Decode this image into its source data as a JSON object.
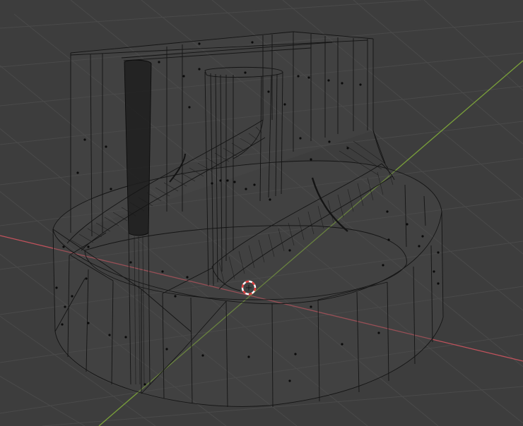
{
  "viewport": {
    "mode": "wireframe",
    "background_color": "#3d3d3d",
    "grid_color": "#4a4a4a",
    "x_axis_color": "#c1525c",
    "y_axis_color": "#7aa03a",
    "wire_color": "#141414",
    "surface_tint": "#4b4b4b",
    "cursor_colors": [
      "#e23b3b",
      "#ffffff"
    ],
    "icons": [
      "3d-cursor-icon"
    ]
  }
}
